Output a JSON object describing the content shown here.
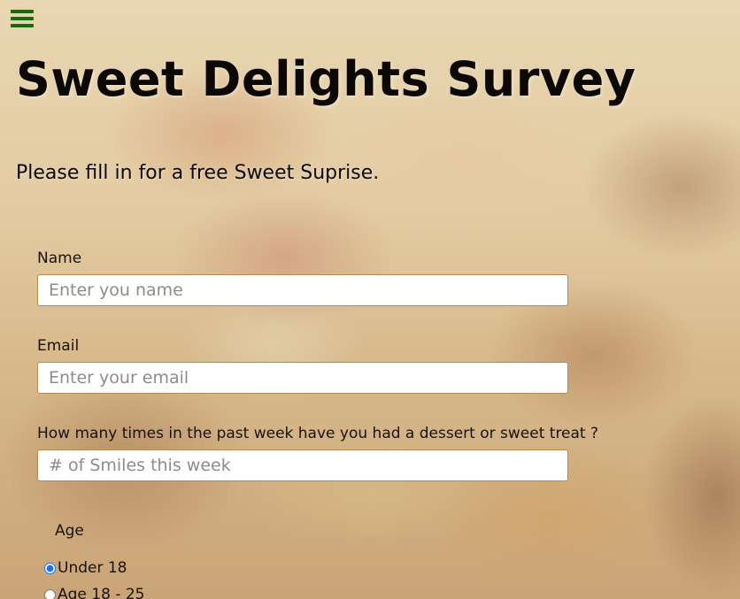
{
  "nav": {
    "menu_icon": "hamburger-menu-icon",
    "menu_color": "#176b0f"
  },
  "header": {
    "title": "Sweet Delights Survey",
    "subtitle": "Please fill in for a free Sweet Suprise."
  },
  "form": {
    "name": {
      "label": "Name",
      "placeholder": "Enter you name",
      "value": ""
    },
    "email": {
      "label": "Email",
      "placeholder": "Enter your email",
      "value": ""
    },
    "smiles": {
      "label": "How many times in the past week have you had a dessert or sweet treat ?",
      "placeholder": "# of Smiles this week",
      "value": ""
    },
    "age": {
      "label": "Age",
      "options": [
        {
          "label": "Under 18",
          "selected": true
        },
        {
          "label": "Age 18 - 25",
          "selected": false
        }
      ]
    }
  }
}
